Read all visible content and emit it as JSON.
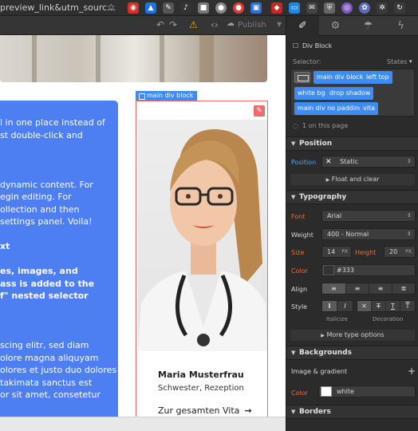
{
  "browser": {
    "url_fragment": "preview_link&utm_sourc…",
    "star_icon": "star-icon"
  },
  "designer": {
    "toolbar": {
      "undo_icon": "undo-icon",
      "redo_icon": "redo-icon",
      "warning_icon": "warning-icon",
      "code_icon": "code-icon",
      "publish_label": "Publish"
    }
  },
  "canvas": {
    "blue_card_lines": [
      "l in one place instead of",
      "st double-click and",
      "",
      "",
      "",
      "dynamic content. For",
      "egin editing. For",
      "ollection and then",
      "settings panel. Voila!",
      "",
      "xt",
      "",
      "es, images, and",
      "ass is added to the",
      "f\" nested selector",
      "",
      "",
      "",
      "scing elitr, sed diam",
      "olore magna aliquyam",
      "olores et justo duo dolores",
      "takimata sanctus est",
      "or sit amet, consetetur"
    ],
    "selection_label": "main div block",
    "person": {
      "name": "Maria Musterfrau",
      "role": "Schwester, Rezeption",
      "link": "Zur gesamten Vita",
      "arrow": "→"
    }
  },
  "panel": {
    "tabs": [
      "brush-icon",
      "gear-icon",
      "drops-icon",
      "bolt-icon"
    ],
    "element_type": "Div Block",
    "selector_label": "Selector:",
    "states_label": "States",
    "chips": [
      "main div block",
      "left top",
      "white bg",
      "drop shadow",
      "main div no padding",
      "vita"
    ],
    "on_this_page": "1 on this page",
    "position": {
      "section": "Position",
      "label": "Position",
      "value": "Static",
      "float_clear": "Float and clear"
    },
    "typography": {
      "section": "Typography",
      "font_label": "Font",
      "font_value": "Arial",
      "weight_label": "Weight",
      "weight_value": "400 - Normal",
      "size_label": "Size",
      "size_value": "14",
      "size_unit": "PX",
      "height_label": "Height",
      "height_value": "20",
      "height_unit": "PX",
      "color_label": "Color",
      "color_value": "#333",
      "align_label": "Align",
      "style_label": "Style",
      "italicize_label": "Italicize",
      "decoration_label": "Decoration",
      "more_options": "More type options"
    },
    "backgrounds": {
      "section": "Backgrounds",
      "image_gradient": "Image & gradient",
      "color_label": "Color",
      "color_value": "white"
    },
    "borders": {
      "section": "Borders"
    }
  },
  "colors": {
    "accent_blue": "#3e8cf2",
    "card_blue": "#4d7ff2",
    "warning_orange": "#e2703a",
    "selection_red": "#f06b6b"
  }
}
